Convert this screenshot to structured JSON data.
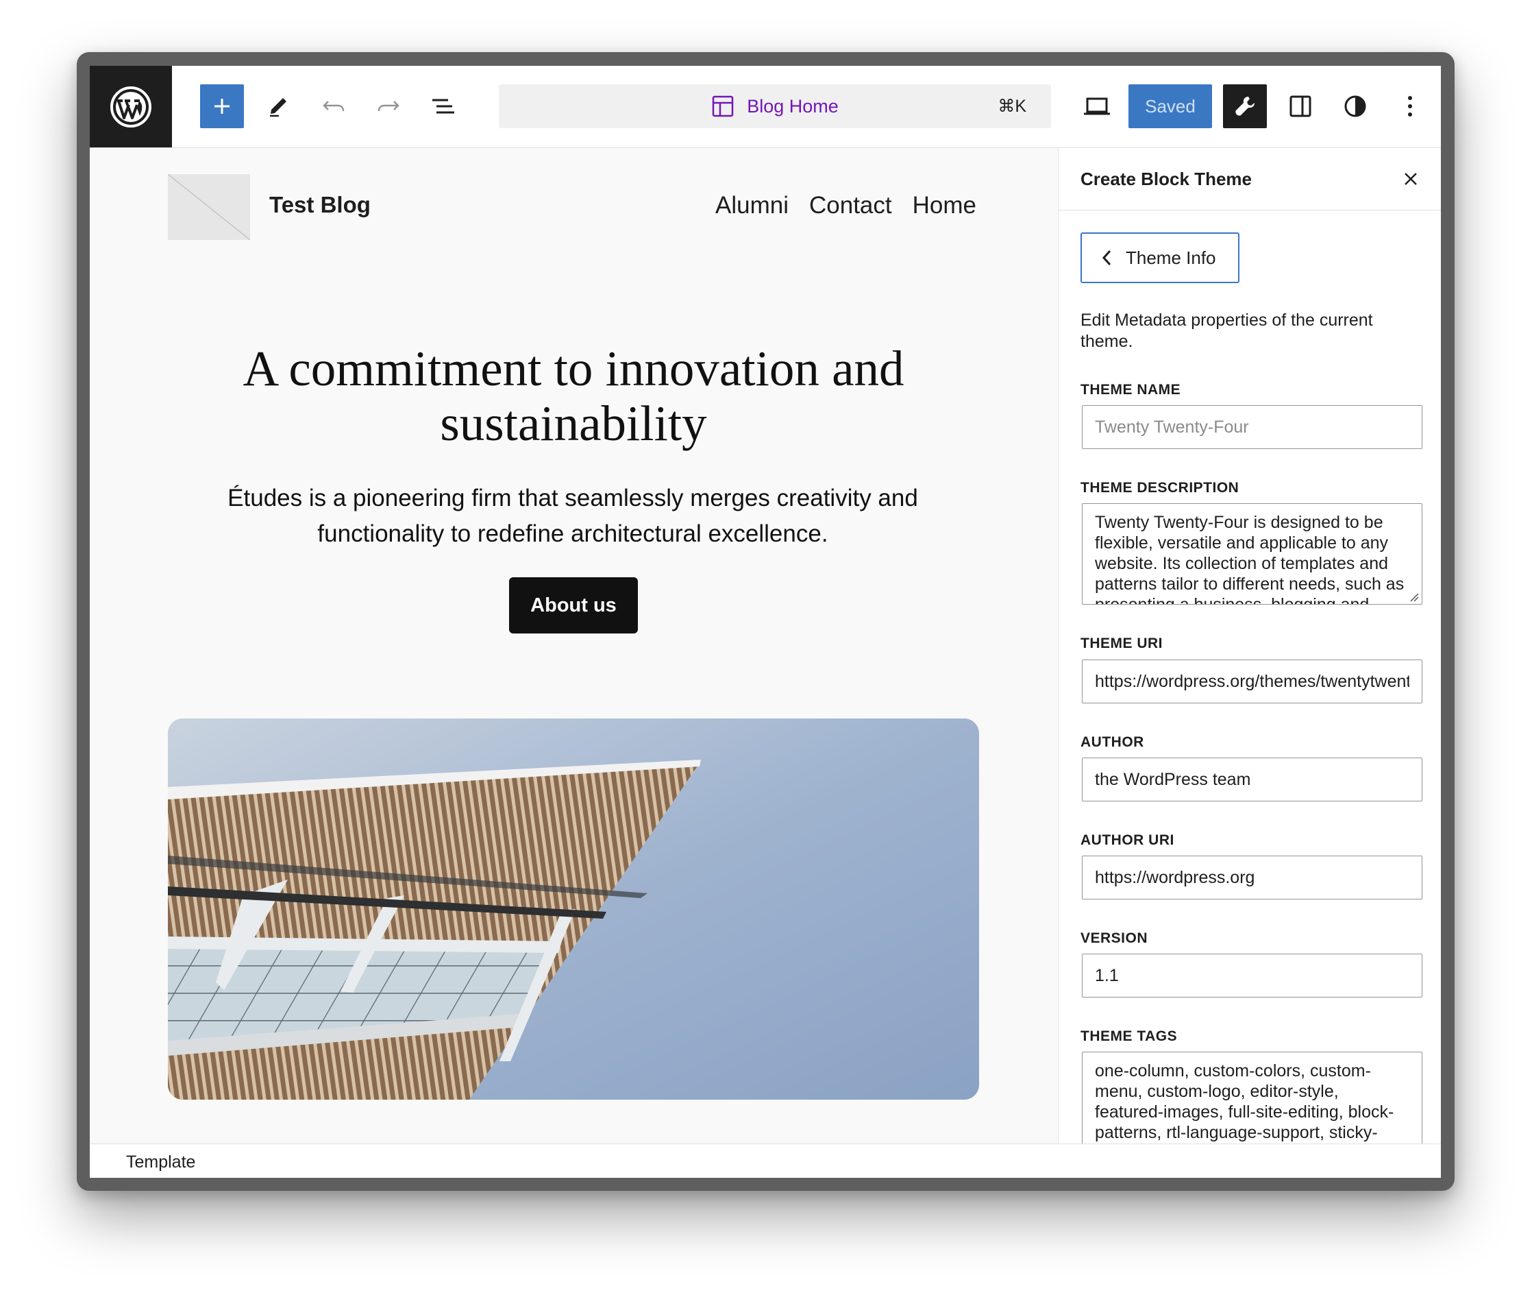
{
  "toolbar": {
    "document_title": "Blog Home",
    "shortcut": "⌘K",
    "save_label": "Saved"
  },
  "site": {
    "title": "Test Blog",
    "nav": [
      "Alumni",
      "Contact",
      "Home"
    ]
  },
  "hero": {
    "title": "A commitment to innovation and sustainability",
    "text": "Études is a pioneering firm that seamlessly merges creativity and functionality to redefine architectural excellence.",
    "button_label": "About us"
  },
  "sidebar": {
    "title": "Create Block Theme",
    "back_label": "Theme Info",
    "description": "Edit Metadata properties of the current theme.",
    "fields": {
      "theme_name": {
        "label": "THEME NAME",
        "value": "",
        "placeholder": "Twenty Twenty-Four"
      },
      "theme_description": {
        "label": "THEME DESCRIPTION",
        "value": "Twenty Twenty-Four is designed to be flexible, versatile and applicable to any website. Its collection of templates and patterns tailor to different needs, such as presenting a business, blogging and writing or showcasing work."
      },
      "theme_uri": {
        "label": "THEME URI",
        "value": "https://wordpress.org/themes/twentytwentyfour/"
      },
      "author": {
        "label": "AUTHOR",
        "value": "the WordPress team"
      },
      "author_uri": {
        "label": "AUTHOR URI",
        "value": "https://wordpress.org"
      },
      "version": {
        "label": "VERSION",
        "value": "1.1"
      },
      "theme_tags": {
        "label": "THEME TAGS",
        "value": "one-column, custom-colors, custom-menu, custom-logo, editor-style, featured-images, full-site-editing, block-patterns, rtl-language-support, sticky-post, threaded-comments, translation-ready, wide-blocks, block-styles, style-variations, accessibility-ready, blog, portfolio, news"
      }
    }
  },
  "status_bar": {
    "label": "Template"
  },
  "icons": [
    "wordpress-logo-icon",
    "plus-icon",
    "pencil-icon",
    "undo-icon",
    "redo-icon",
    "list-view-icon",
    "template-icon",
    "desktop-preview-icon",
    "wrench-icon",
    "sidebar-toggle-icon",
    "styles-contrast-icon",
    "more-options-icon",
    "close-icon",
    "chevron-left-icon"
  ],
  "colors": {
    "accent": "#3b78c4",
    "document_title": "#7316b8",
    "dark": "#1e1e1e"
  }
}
